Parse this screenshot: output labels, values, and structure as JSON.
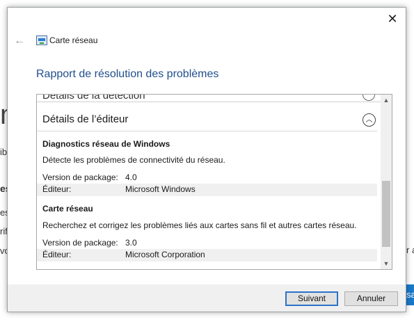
{
  "background": {
    "fragments": [
      "m",
      "ib",
      "es",
      "es",
      "rif",
      "vo"
    ],
    "dot": ".",
    "right_char": "r a",
    "blue_button_text": "sa"
  },
  "window": {
    "close_glyph": "✕",
    "back_glyph": "←",
    "app_title": "Carte réseau",
    "heading": "Rapport de résolution des problèmes"
  },
  "panel": {
    "cut_title": "Détails de la détection",
    "section_title": "Détails de l’éditeur",
    "groups": [
      {
        "title": "Diagnostics réseau de Windows",
        "description": "Détecte les problèmes de connectivité du réseau.",
        "rows": [
          {
            "label": "Version de package:",
            "value": "4.0"
          },
          {
            "label": "Éditeur:",
            "value": "Microsoft Windows"
          }
        ]
      },
      {
        "title": "Carte réseau",
        "description": "Recherchez et corrigez les problèmes liés aux cartes sans fil et autres cartes réseau.",
        "rows": [
          {
            "label": "Version de package:",
            "value": "3.0"
          },
          {
            "label": "Éditeur:",
            "value": "Microsoft Corporation"
          }
        ]
      }
    ]
  },
  "footer": {
    "next_label": "Suivant",
    "cancel_label": "Annuler"
  },
  "icons": {
    "back": "back-arrow-icon",
    "app": "network-adapter-icon",
    "collapse": "chevron-up-icon",
    "close": "close-icon"
  }
}
